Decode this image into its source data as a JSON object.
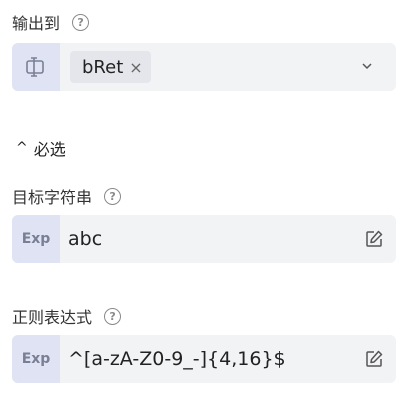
{
  "output": {
    "label": "输出到",
    "help_icon": "question-circle-icon",
    "prefix_icon": "variable-icon",
    "tag": "bRet",
    "tag_remove": "×",
    "dropdown_icon": "chevron-down-icon"
  },
  "section": {
    "caret": "^",
    "label": "必选"
  },
  "target_string": {
    "label": "目标字符串",
    "help_icon": "question-circle-icon",
    "prefix": "Exp",
    "value": "abc",
    "edit_icon": "edit-icon"
  },
  "regex": {
    "label": "正则表达式",
    "help_icon": "question-circle-icon",
    "prefix": "Exp",
    "value": "^[a-zA-Z0-9_-]{4,16}$",
    "edit_icon": "edit-icon"
  }
}
